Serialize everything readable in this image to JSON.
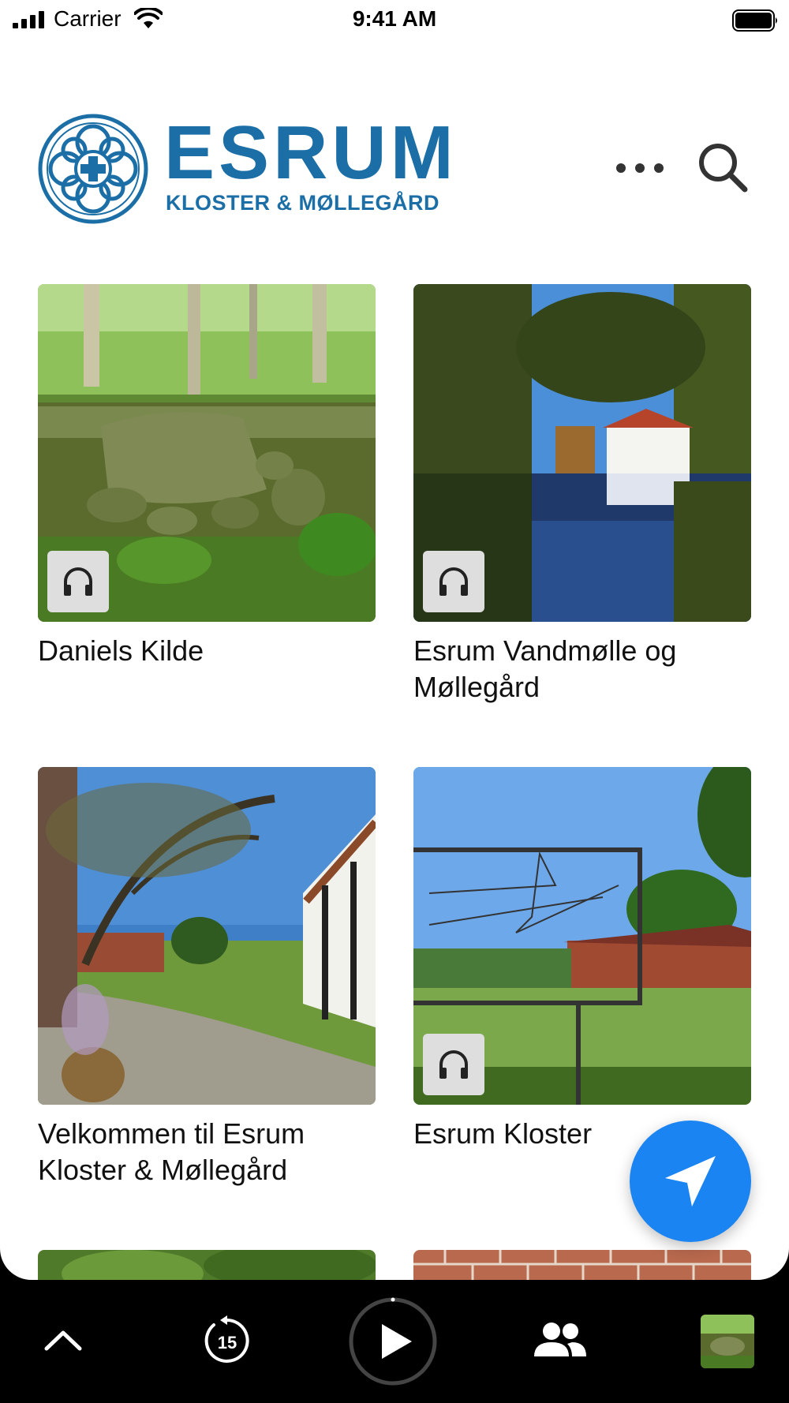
{
  "status_bar": {
    "carrier": "Carrier",
    "time": "9:41 AM"
  },
  "header": {
    "title": "ESRUM",
    "subtitle": "KLOSTER & MØLLEGÅRD",
    "brand_color": "#1b6fa6",
    "more_icon": "ellipsis-icon",
    "search_icon": "search-icon"
  },
  "cards": [
    {
      "title": "Daniels Kilde",
      "has_audio": true
    },
    {
      "title": "Esrum Vandmølle og Møllegård",
      "has_audio": true
    },
    {
      "title": "Velkommen til Esrum Kloster & Møllegård",
      "has_audio": false
    },
    {
      "title": "Esrum Kloster",
      "has_audio": true
    }
  ],
  "fab": {
    "icon": "navigation-arrow-icon",
    "color": "#1a85f2"
  },
  "player_bar": {
    "items": [
      {
        "icon": "chevron-up-icon"
      },
      {
        "icon": "rewind-15-icon",
        "label": "15"
      },
      {
        "icon": "play-icon"
      },
      {
        "icon": "people-icon"
      },
      {
        "icon": "thumbnail-image"
      }
    ]
  }
}
